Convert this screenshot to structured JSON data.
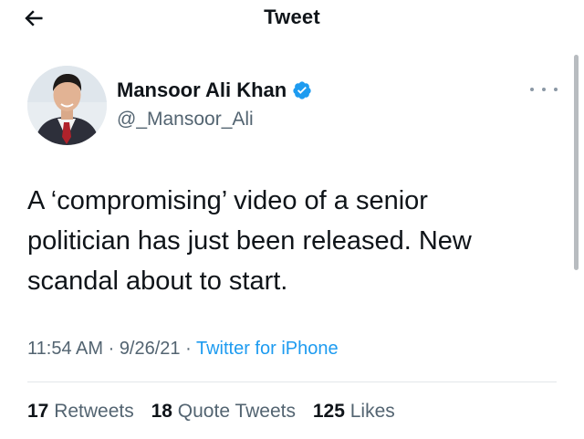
{
  "header": {
    "back_icon": "arrow-left-icon",
    "title": "Tweet"
  },
  "author": {
    "name": "Mansoor Ali Khan",
    "handle": "@_Mansoor_Ali",
    "verified_icon": "verified-badge-icon",
    "verified_color": "#1d9bf0"
  },
  "more_icon": "more-horizontal-icon",
  "tweet": {
    "lines": [
      "A ‘compromising’ video of a senior",
      "politician has just been released. New",
      "scandal about to start."
    ]
  },
  "meta": {
    "time": "11:54 AM",
    "separator": " · ",
    "date": "9/26/21",
    "source": "Twitter for iPhone"
  },
  "stats": {
    "retweets_count": "17",
    "retweets_label": "Retweets",
    "quote_count": "18",
    "quote_label": "Quote Tweets",
    "likes_count": "125",
    "likes_label": "Likes"
  },
  "colors": {
    "text": "#0f1419",
    "secondary": "#536471",
    "link": "#1d9bf0",
    "divider": "#e3e7ea"
  }
}
